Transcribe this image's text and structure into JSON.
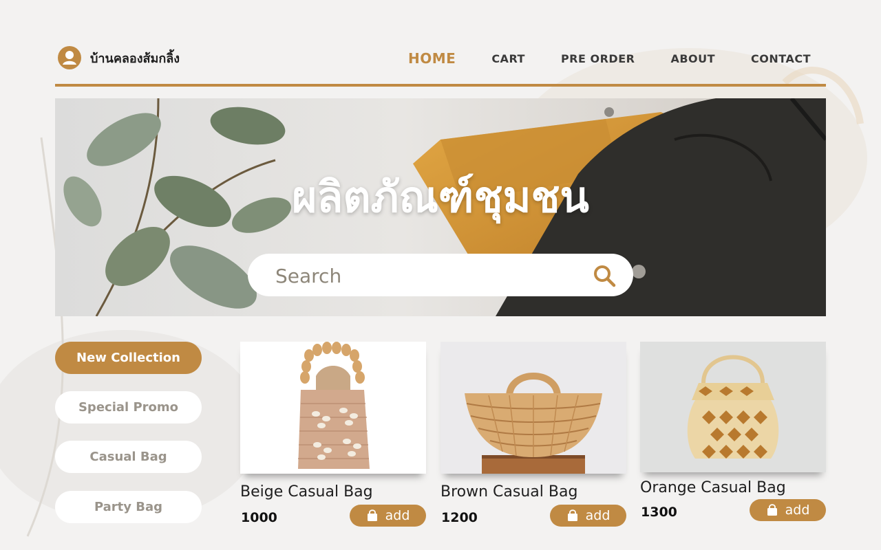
{
  "brand": {
    "name": "บ้านคลองส้มกลิ้ง",
    "icon": "user-icon"
  },
  "nav": [
    {
      "label": "HOME",
      "active": true
    },
    {
      "label": "CART",
      "active": false
    },
    {
      "label": "PRE ORDER",
      "active": false
    },
    {
      "label": "ABOUT",
      "active": false
    },
    {
      "label": "CONTACT",
      "active": false
    }
  ],
  "hero": {
    "title": "ผลิตภัณฑ์ชุมชน",
    "search": {
      "placeholder": "Search",
      "value": "",
      "icon": "search-icon"
    }
  },
  "categories": [
    {
      "label": "New Collection",
      "active": true
    },
    {
      "label": "Special Promo",
      "active": false
    },
    {
      "label": "Casual Bag",
      "active": false
    },
    {
      "label": "Party Bag",
      "active": false
    }
  ],
  "products": [
    {
      "name": "Beige Casual Bag",
      "price": "1000",
      "add_label": "add"
    },
    {
      "name": "Brown Casual Bag",
      "price": "1200",
      "add_label": "add"
    },
    {
      "name": "Orange Casual Bag",
      "price": "1300",
      "add_label": "add"
    }
  ],
  "colors": {
    "accent": "#c08a43",
    "background": "#f3f2f1",
    "text": "#1f1f1f",
    "muted": "#9a948b"
  }
}
